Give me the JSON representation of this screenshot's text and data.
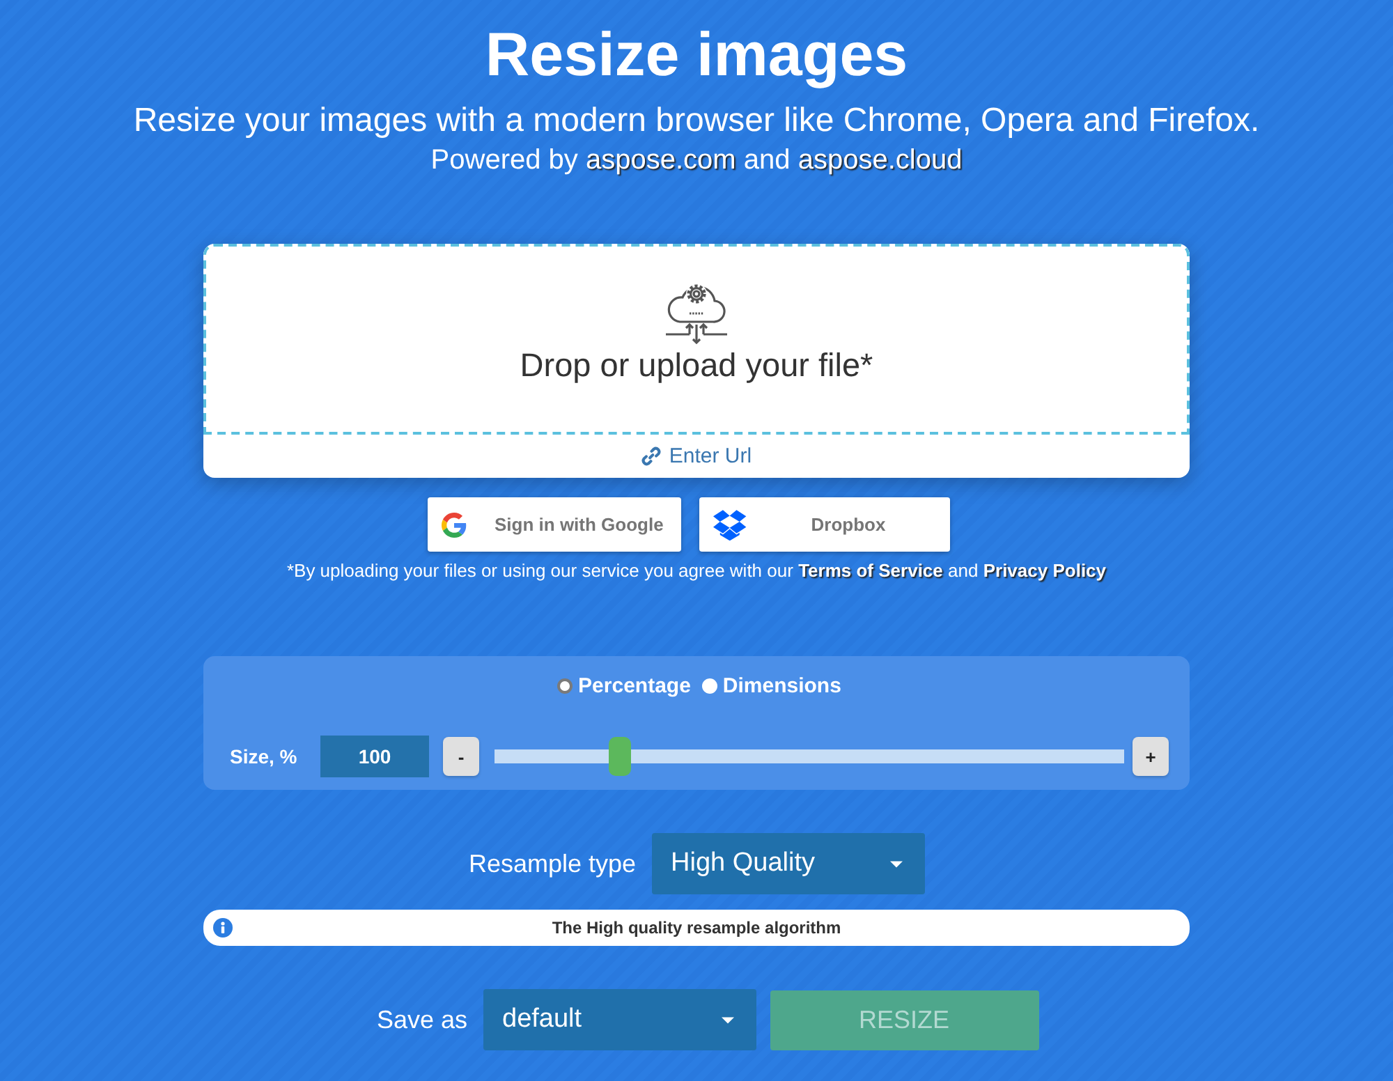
{
  "header": {
    "title": "Resize images",
    "subtitle": "Resize your images with a modern browser like Chrome, Opera and Firefox.",
    "powered_by": [
      {
        "kind": "text",
        "text": "Powered by"
      },
      {
        "kind": "link",
        "text": "aspose.com"
      },
      {
        "kind": "text",
        "text": "and"
      },
      {
        "kind": "link",
        "text": "aspose.cloud"
      }
    ]
  },
  "upload": {
    "prompt": "Drop or upload your file*",
    "url_link": "Enter Url"
  },
  "cloud_buttons": [
    {
      "kind": "google",
      "label": "Sign in with Google"
    },
    {
      "kind": "dropbox",
      "label": "Dropbox"
    }
  ],
  "notice": [
    {
      "kind": "text",
      "text": "*By uploading your files or using our service you agree with our"
    },
    {
      "kind": "link",
      "text": "Terms of Service"
    },
    {
      "kind": "text",
      "text": "and"
    },
    {
      "kind": "link",
      "text": "Privacy Policy"
    }
  ],
  "size_panel": {
    "modes": [
      {
        "label": "Percentage",
        "selected": true
      },
      {
        "label": "Dimensions",
        "selected": false
      }
    ],
    "size_label": "Size, %",
    "value": "100",
    "minus": "-",
    "plus": "+",
    "level": 0.2
  },
  "resample": {
    "label": "Resample type",
    "value": "High Quality",
    "info": "The High quality resample algorithm"
  },
  "save": {
    "label": "Save as",
    "value": "default"
  },
  "resize_button": {
    "label": "RESIZE",
    "disabled": true
  }
}
